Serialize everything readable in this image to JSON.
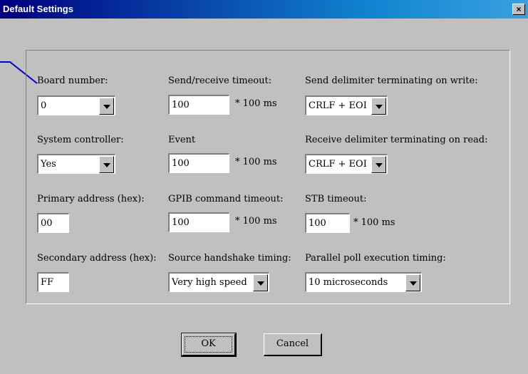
{
  "window": {
    "title": "Default Settings",
    "close_glyph": "×"
  },
  "col1": {
    "board_number_label": "Board number:",
    "board_number_value": "0",
    "system_controller_label": "System controller:",
    "system_controller_value": "Yes",
    "primary_address_label": "Primary address (hex):",
    "primary_address_value": "00",
    "secondary_address_label": "Secondary address (hex):",
    "secondary_address_value": "FF"
  },
  "col2": {
    "send_receive_timeout_label": "Send/receive timeout:",
    "send_receive_timeout_value": "100",
    "send_receive_timeout_unit": "* 100 ms",
    "event_label": "Event",
    "event_value": "100",
    "event_unit": "* 100 ms",
    "gpib_timeout_label": "GPIB command timeout:",
    "gpib_timeout_value": "100",
    "gpib_timeout_unit": "* 100 ms",
    "handshake_label": "Source handshake timing:",
    "handshake_value": "Very high speed"
  },
  "col3": {
    "send_delimiter_label": "Send delimiter terminating on write:",
    "send_delimiter_value": "CRLF + EOI",
    "receive_delimiter_label": "Receive delimiter terminating on read:",
    "receive_delimiter_value": "CRLF + EOI",
    "stb_timeout_label": "STB timeout:",
    "stb_timeout_value": "100",
    "stb_timeout_unit": "* 100 ms",
    "parallel_poll_label": "Parallel poll execution timing:",
    "parallel_poll_value": "10 microseconds"
  },
  "buttons": {
    "ok": "OK",
    "cancel": "Cancel"
  },
  "icons": {
    "dropdown": "chevron-down-icon",
    "close": "close-icon"
  },
  "colors": {
    "title_bar": "#000080",
    "title_bar_end": "#1084d0",
    "dialog_bg": "#c0c0c0",
    "pointer_line": "#0000cc"
  }
}
